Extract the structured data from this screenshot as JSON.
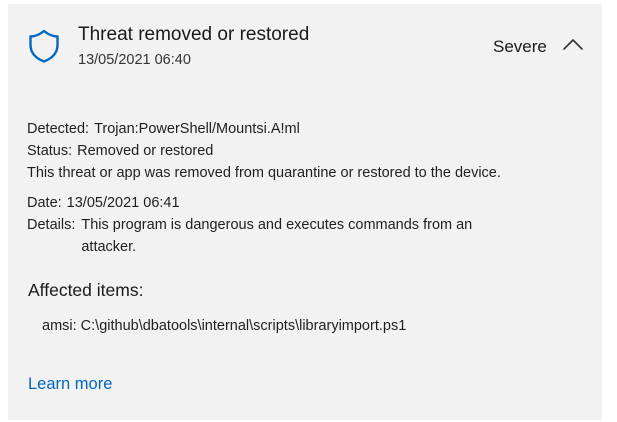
{
  "header": {
    "icon": "shield-icon",
    "title": "Threat removed or restored",
    "timestamp": "13/05/2021 06:40",
    "severity": "Severe",
    "toggle_icon": "chevron-up-icon"
  },
  "details": {
    "detected_label": "Detected:",
    "detected_value": "Trojan:PowerShell/Mountsi.A!ml",
    "status_label": "Status:",
    "status_value": "Removed or restored",
    "description": "This threat or app was removed from quarantine or restored to the device.",
    "date_label": "Date:",
    "date_value": "13/05/2021 06:41",
    "details_label": "Details:",
    "details_value": "This program is dangerous and executes commands from an attacker."
  },
  "affected": {
    "heading": "Affected items:",
    "items": [
      {
        "text": "amsi: C:\\github\\dbatools\\internal\\scripts\\libraryimport.ps1"
      }
    ]
  },
  "links": {
    "learn_more": "Learn more"
  },
  "colors": {
    "card_background": "#f2f2f2",
    "accent": "#0067c0",
    "shield_stroke": "#0067c0"
  }
}
